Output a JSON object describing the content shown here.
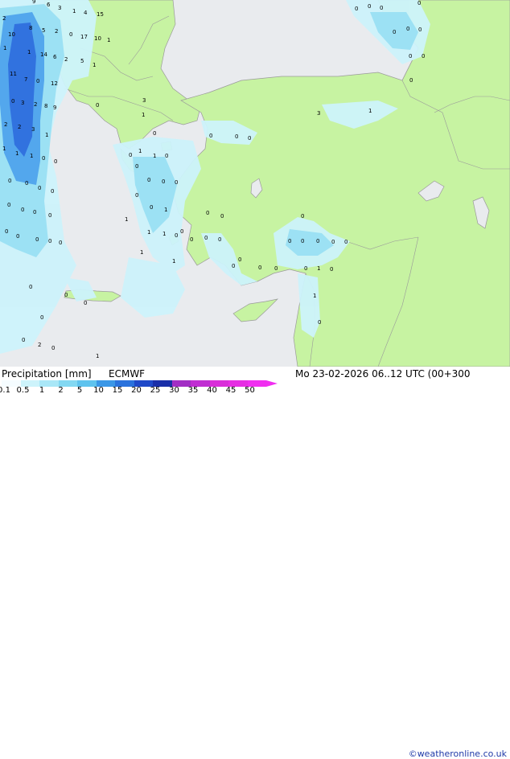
{
  "map": {
    "values": [
      "2",
      "9",
      "6",
      "3",
      "1",
      "4",
      "15",
      "10",
      "8",
      "5",
      "2",
      "0",
      "17",
      "10",
      "1",
      "1",
      "1",
      "14",
      "6",
      "2",
      "5",
      "1",
      "11",
      "7",
      "0",
      "12",
      "0",
      "3",
      "2",
      "8",
      "9",
      "2",
      "2",
      "3",
      "1",
      "1",
      "1",
      "1",
      "0",
      "0",
      "0",
      "0",
      "0",
      "0",
      "0",
      "0",
      "0",
      "0",
      "0",
      "0",
      "0",
      "0",
      "0",
      "0",
      "0",
      "0",
      "0",
      "0",
      "2",
      "0",
      "1",
      "1",
      "1",
      "0",
      "0",
      "0",
      "0",
      "0",
      "0",
      "0",
      "1",
      "1",
      "1",
      "1",
      "0",
      "1",
      "1",
      "3",
      "3",
      "1",
      "0",
      "0",
      "0",
      "0",
      "0",
      "0",
      "0",
      "0",
      "0",
      "0",
      "0",
      "0",
      "0",
      "0",
      "0",
      "0",
      "1",
      "0",
      "0",
      "1",
      "0",
      "0",
      "0",
      "0",
      "0",
      "0",
      "0",
      "0",
      "0",
      "0",
      "0",
      "0",
      "0",
      "1",
      "0",
      "0",
      "0",
      "0"
    ],
    "colors": {
      "sea": "#e9ebee",
      "land": "#c7f3a2",
      "border": "#9a9a9a",
      "precip_light": "#cdf3fb",
      "precip_mid": "#99dff3",
      "precip_heavy": "#4fa3ec",
      "precip_vheavy": "#2f6fde"
    }
  },
  "footer": {
    "title": "Precipitation [mm]",
    "model": "ECMWF",
    "datetime": "Mo 23-02-2026 06..12 UTC (00+300",
    "copyright": "©weatheronline.co.uk",
    "scale_labels": [
      "0.1",
      "0.5",
      "1",
      "2",
      "5",
      "10",
      "15",
      "20",
      "25",
      "30",
      "35",
      "40",
      "45",
      "50"
    ],
    "scale_colors": [
      "#f5fcff",
      "#cdf3fb",
      "#a9e7f7",
      "#83d8f2",
      "#5fc3ee",
      "#3b97e6",
      "#2a72dc",
      "#1f49c8",
      "#1a2fa8",
      "#a22ec4",
      "#c02ed2",
      "#d92ed9",
      "#e62ee3",
      "#f02ef0"
    ]
  }
}
